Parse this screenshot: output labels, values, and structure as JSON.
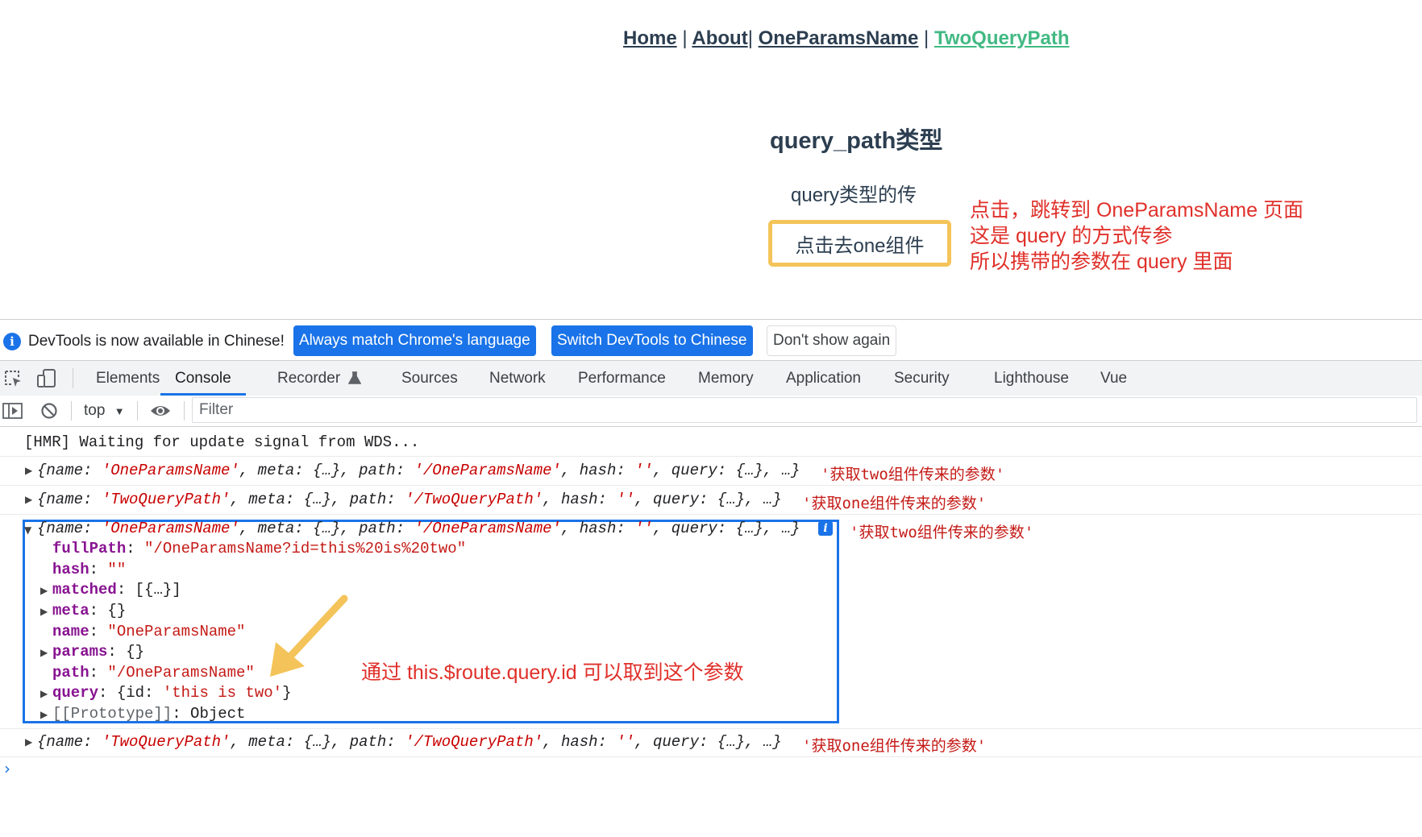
{
  "app": {
    "nav": [
      {
        "label": "Home"
      },
      {
        "label": "About"
      },
      {
        "label": "OneParamsName"
      },
      {
        "label": "TwoQueryPath"
      }
    ],
    "separator": "|",
    "heading": "query_path类型",
    "text": "query类型的传",
    "button_label": "点击去one组件",
    "nav_active_color": "#42b983"
  },
  "annotations": {
    "right_note": [
      "点击，跳转到 OneParamsName 页面",
      "这是 query 的方式传参",
      "所以携带的参数在 query 里面"
    ],
    "arrow_note": "通过 this.$route.query.id   可以取到这个参数",
    "color": "#e0302a"
  },
  "devtools": {
    "infobar": {
      "message": "DevTools is now available in Chinese!",
      "btn_match": "Always match Chrome's language",
      "btn_switch": "Switch DevTools to Chinese",
      "btn_dismiss": "Don't show again"
    },
    "tabs": [
      "Elements",
      "Console",
      "Recorder",
      "Sources",
      "Network",
      "Performance",
      "Memory",
      "Application",
      "Security",
      "Lighthouse",
      "Vue"
    ],
    "active_tab": "Console",
    "toolbar": {
      "context": "top",
      "filter_placeholder": "Filter"
    }
  },
  "console": {
    "hmr": "[HMR] Waiting for update signal from WDS...",
    "rows": [
      {
        "name": "'OneParamsName'",
        "path": "'/OneParamsName'",
        "msg": "'获取two组件传来的参数'"
      },
      {
        "name": "'TwoQueryPath'",
        "path": "'/TwoQueryPath'",
        "msg": "'获取one组件传来的参数'"
      },
      {
        "name": "'OneParamsName'",
        "path": "'/OneParamsName'",
        "msg": "'获取two组件传来的参数'"
      },
      {
        "name": "'TwoQueryPath'",
        "path": "'/TwoQueryPath'",
        "msg": "'获取one组件传来的参数'"
      }
    ],
    "obj": {
      "open": "{name: ",
      "meta": ", meta: {…}, path: ",
      "hash": ", hash: ",
      "empty": "''",
      "tail": ", query: {…}, …}"
    },
    "expanded": {
      "fullPath_key": "fullPath",
      "fullPath_val": "\"/OneParamsName?id=this%20is%20two\"",
      "hash_key": "hash",
      "hash_val": "\"\"",
      "matched_key": "matched",
      "matched_val": "[{…}]",
      "meta_key": "meta",
      "meta_val": "{}",
      "name_key": "name",
      "name_val": "\"OneParamsName\"",
      "params_key": "params",
      "params_val": "{}",
      "path_key": "path",
      "path_val": "\"/OneParamsName\"",
      "query_key": "query",
      "query_open": "{id: ",
      "query_val": "'this is two'",
      "query_close": "}",
      "proto_key": "[[Prototype]]",
      "proto_val": "Object"
    }
  }
}
